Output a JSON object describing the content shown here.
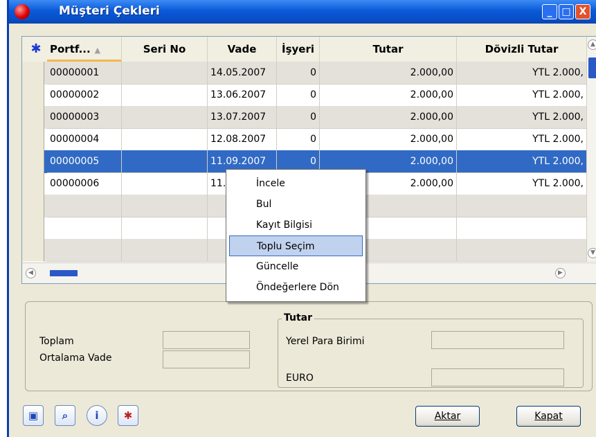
{
  "window": {
    "title": "Müşteri Çekleri",
    "buttons": {
      "minimize": "_",
      "maximize": "□",
      "close": "X"
    }
  },
  "grid": {
    "columns": [
      "Portf...",
      "Seri No",
      "Vade",
      "İşyeri",
      "Tutar",
      "Dövizli Tutar"
    ],
    "sorted_column_indicator": "▲",
    "selected_row": 4,
    "rows": [
      {
        "portfoy": "00000001",
        "seri_no": "",
        "vade": "14.05.2007",
        "isyeri": "0",
        "tutar": "2.000,00",
        "dovizli": "YTL 2.000,"
      },
      {
        "portfoy": "00000002",
        "seri_no": "",
        "vade": "13.06.2007",
        "isyeri": "0",
        "tutar": "2.000,00",
        "dovizli": "YTL 2.000,"
      },
      {
        "portfoy": "00000003",
        "seri_no": "",
        "vade": "13.07.2007",
        "isyeri": "0",
        "tutar": "2.000,00",
        "dovizli": "YTL 2.000,"
      },
      {
        "portfoy": "00000004",
        "seri_no": "",
        "vade": "12.08.2007",
        "isyeri": "0",
        "tutar": "2.000,00",
        "dovizli": "YTL 2.000,"
      },
      {
        "portfoy": "00000005",
        "seri_no": "",
        "vade": "11.09.2007",
        "isyeri": "0",
        "tutar": "2.000,00",
        "dovizli": "YTL 2.000,"
      },
      {
        "portfoy": "00000006",
        "seri_no": "",
        "vade": "11.",
        "isyeri": "",
        "tutar": "2.000,00",
        "dovizli": "YTL 2.000,"
      }
    ]
  },
  "context_menu": {
    "items": [
      "İncele",
      "Bul",
      "Kayıt Bilgisi",
      "Toplu Seçim",
      "Güncelle",
      "Öndeğerlere Dön"
    ],
    "highlighted_index": 3
  },
  "summary": {
    "toplam_label": "Toplam",
    "toplam_value": "",
    "ortalama_vade_label": "Ortalama Vade",
    "ortalama_vade_value": "",
    "tutar_group_title": "Tutar",
    "yerel_para_birimi_label": "Yerel Para Birimi",
    "yerel_para_birimi_value": "",
    "euro_label": "EURO",
    "euro_value": ""
  },
  "footer": {
    "aktar_label": "Aktar",
    "kapat_label": "Kapat",
    "icons": [
      "preview-icon",
      "search-icon",
      "info-icon",
      "multi-select-icon"
    ]
  }
}
